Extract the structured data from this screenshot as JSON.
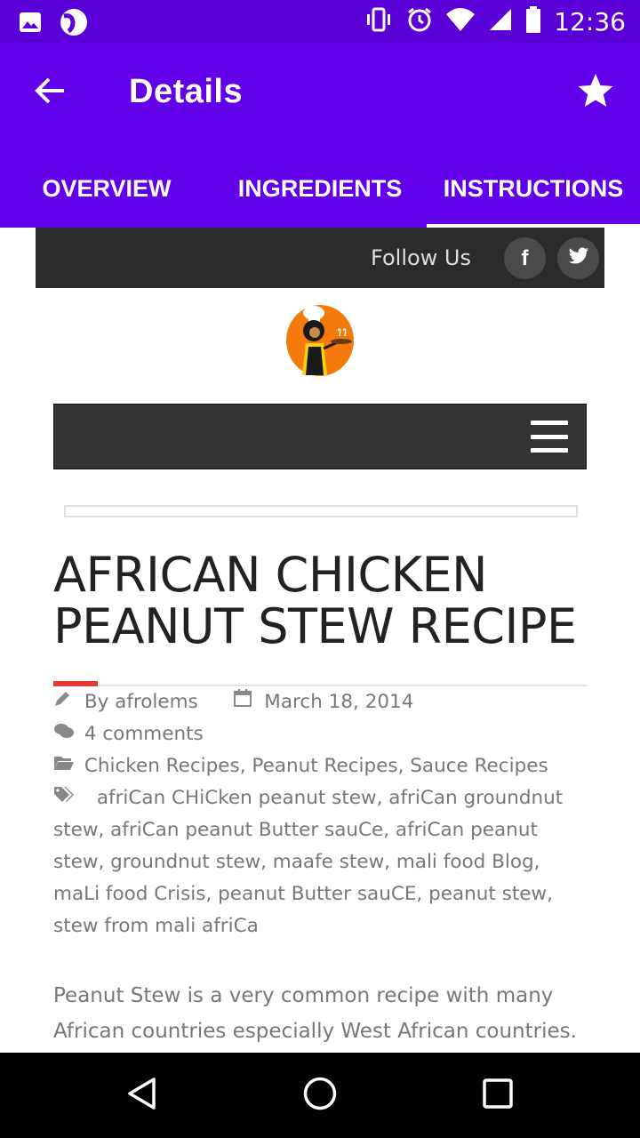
{
  "status_bar": {
    "time": "12:36",
    "icons": [
      "image-icon",
      "app-notification-icon",
      "vibrate-icon",
      "alarm-icon",
      "wifi-icon",
      "signal-icon",
      "battery-icon"
    ]
  },
  "app_bar": {
    "title": "Details",
    "back_icon": "arrow-back-icon",
    "favorite_icon": "star-icon",
    "color": "#6200ea"
  },
  "tabs": [
    {
      "label": "OVERVIEW",
      "active": false
    },
    {
      "label": "INGREDIENTS",
      "active": false
    },
    {
      "label": "INSTRUCTIONS",
      "active": true
    }
  ],
  "web": {
    "follow_us": "Follow Us",
    "social": [
      {
        "name": "facebook",
        "glyph": "f"
      },
      {
        "name": "twitter",
        "glyph": "t"
      }
    ],
    "post": {
      "title": "AFRICAN CHICKEN PEANUT STEW RECIPE",
      "author": "By afrolems",
      "date": "March 18, 2014",
      "comments": "4 comments",
      "categories": "Chicken Recipes, Peanut Recipes, Sauce Recipes",
      "tags": "afriCan CHiCken peanut stew, afriCan groundnut stew, afriCan peanut Butter sauCe, afriCan peanut stew, groundnut stew, maafe stew, mali food Blog, maLi food Crisis, peanut Butter sauCE, peanut stew, stew from mali afriCa",
      "body": "Peanut Stew is a very common recipe with many African countries especially West African countries."
    },
    "accent_color": "#e53935"
  },
  "nav_bar": {
    "buttons": [
      "back-triangle-icon",
      "home-circle-icon",
      "recents-square-icon"
    ]
  }
}
